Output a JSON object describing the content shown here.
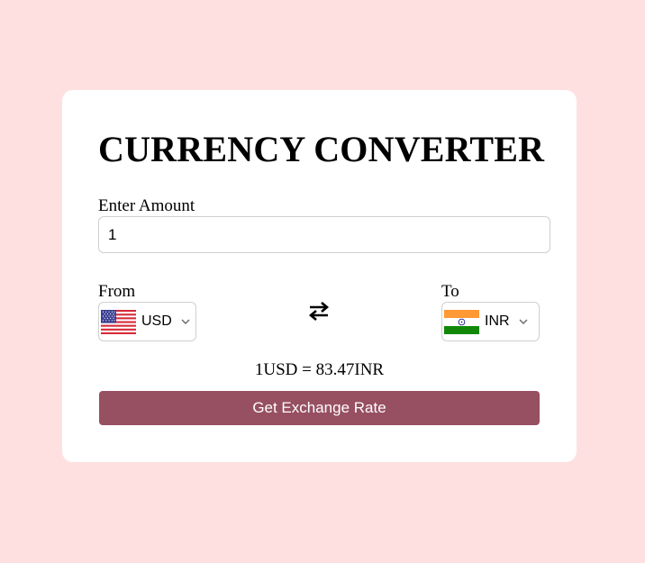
{
  "title": "CURRENCY CONVERTER",
  "amount": {
    "label": "Enter Amount",
    "value": "1"
  },
  "from": {
    "label": "From",
    "currency": "USD",
    "flag_icon": "us-flag-icon"
  },
  "to": {
    "label": "To",
    "currency": "INR",
    "flag_icon": "india-flag-icon"
  },
  "swap_icon": "swap-arrows-icon",
  "result": {
    "text": "1USD = 83.47INR"
  },
  "button": {
    "label": "Get Exchange Rate"
  },
  "colors": {
    "background": "#ffe0e1",
    "card": "#ffffff",
    "button": "#974f62",
    "button_text": "#ffffff"
  }
}
